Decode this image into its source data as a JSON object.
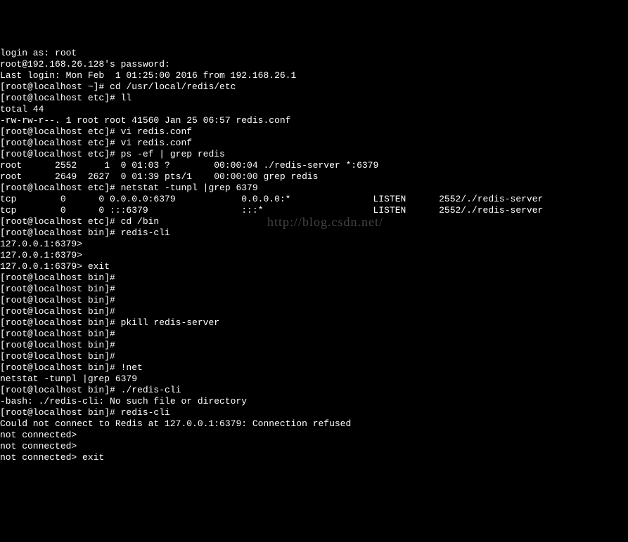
{
  "lines": [
    "login as: root",
    "root@192.168.26.128's password:",
    "Last login: Mon Feb  1 01:25:00 2016 from 192.168.26.1",
    "[root@localhost ~]# cd /usr/local/redis/etc",
    "[root@localhost etc]# ll",
    "total 44",
    "-rw-rw-r--. 1 root root 41560 Jan 25 06:57 redis.conf",
    "[root@localhost etc]# vi redis.conf",
    "[root@localhost etc]# vi redis.conf",
    "[root@localhost etc]# ps -ef | grep redis",
    "root      2552     1  0 01:03 ?        00:00:04 ./redis-server *:6379",
    "root      2649  2627  0 01:39 pts/1    00:00:00 grep redis",
    "[root@localhost etc]# netstat -tunpl |grep 6379",
    "tcp        0      0 0.0.0.0:6379            0.0.0.0:*               LISTEN      2552/./redis-server",
    "tcp        0      0 :::6379                 :::*                    LISTEN      2552/./redis-server",
    "[root@localhost etc]# cd /bin",
    "[root@localhost bin]# redis-cli",
    "127.0.0.1:6379>",
    "127.0.0.1:6379>",
    "127.0.0.1:6379> exit",
    "[root@localhost bin]#",
    "[root@localhost bin]#",
    "[root@localhost bin]#",
    "[root@localhost bin]#",
    "[root@localhost bin]# pkill redis-server",
    "[root@localhost bin]#",
    "[root@localhost bin]#",
    "[root@localhost bin]#",
    "[root@localhost bin]# !net",
    "netstat -tunpl |grep 6379",
    "[root@localhost bin]# ./redis-cli",
    "-bash: ./redis-cli: No such file or directory",
    "[root@localhost bin]# redis-cli",
    "Could not connect to Redis at 127.0.0.1:6379: Connection refused",
    "not connected>",
    "not connected>",
    "not connected> exit"
  ],
  "watermark": "http://blog.csdn.net/"
}
